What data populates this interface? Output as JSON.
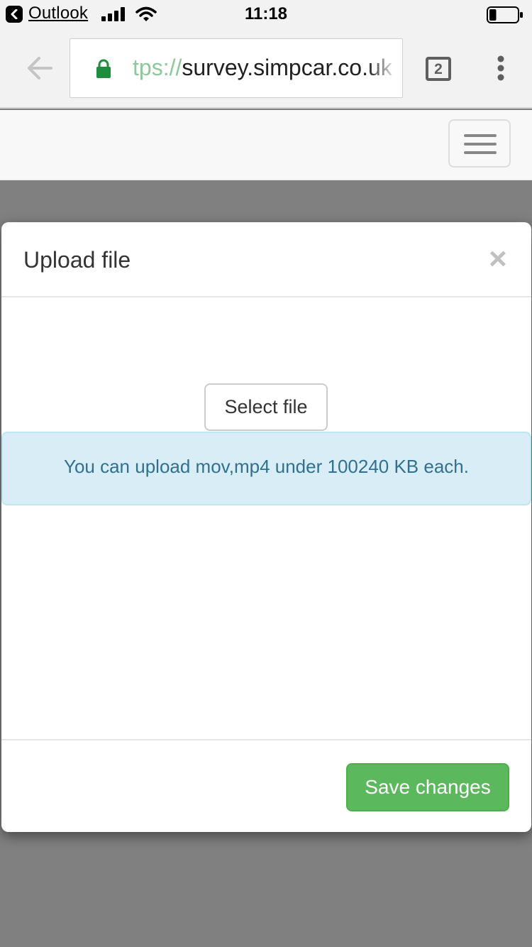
{
  "status_bar": {
    "back_app": "Outlook",
    "time": "11:18",
    "battery_level": 0.25
  },
  "browser": {
    "url_scheme_partial": "tps://",
    "url_host": "survey.simpcar.co.uk",
    "tab_count": "2",
    "secure_lock_color": "#1e8e3e"
  },
  "modal": {
    "title": "Upload file",
    "close_glyph": "×",
    "select_file_label": "Select file",
    "info_message": "You can upload mov,mp4 under 100240 KB each.",
    "save_label": "Save changes"
  },
  "colors": {
    "save_button": "#5cb85c",
    "info_background": "#d9edf7",
    "info_text": "#31708f",
    "backdrop": "#808080"
  }
}
